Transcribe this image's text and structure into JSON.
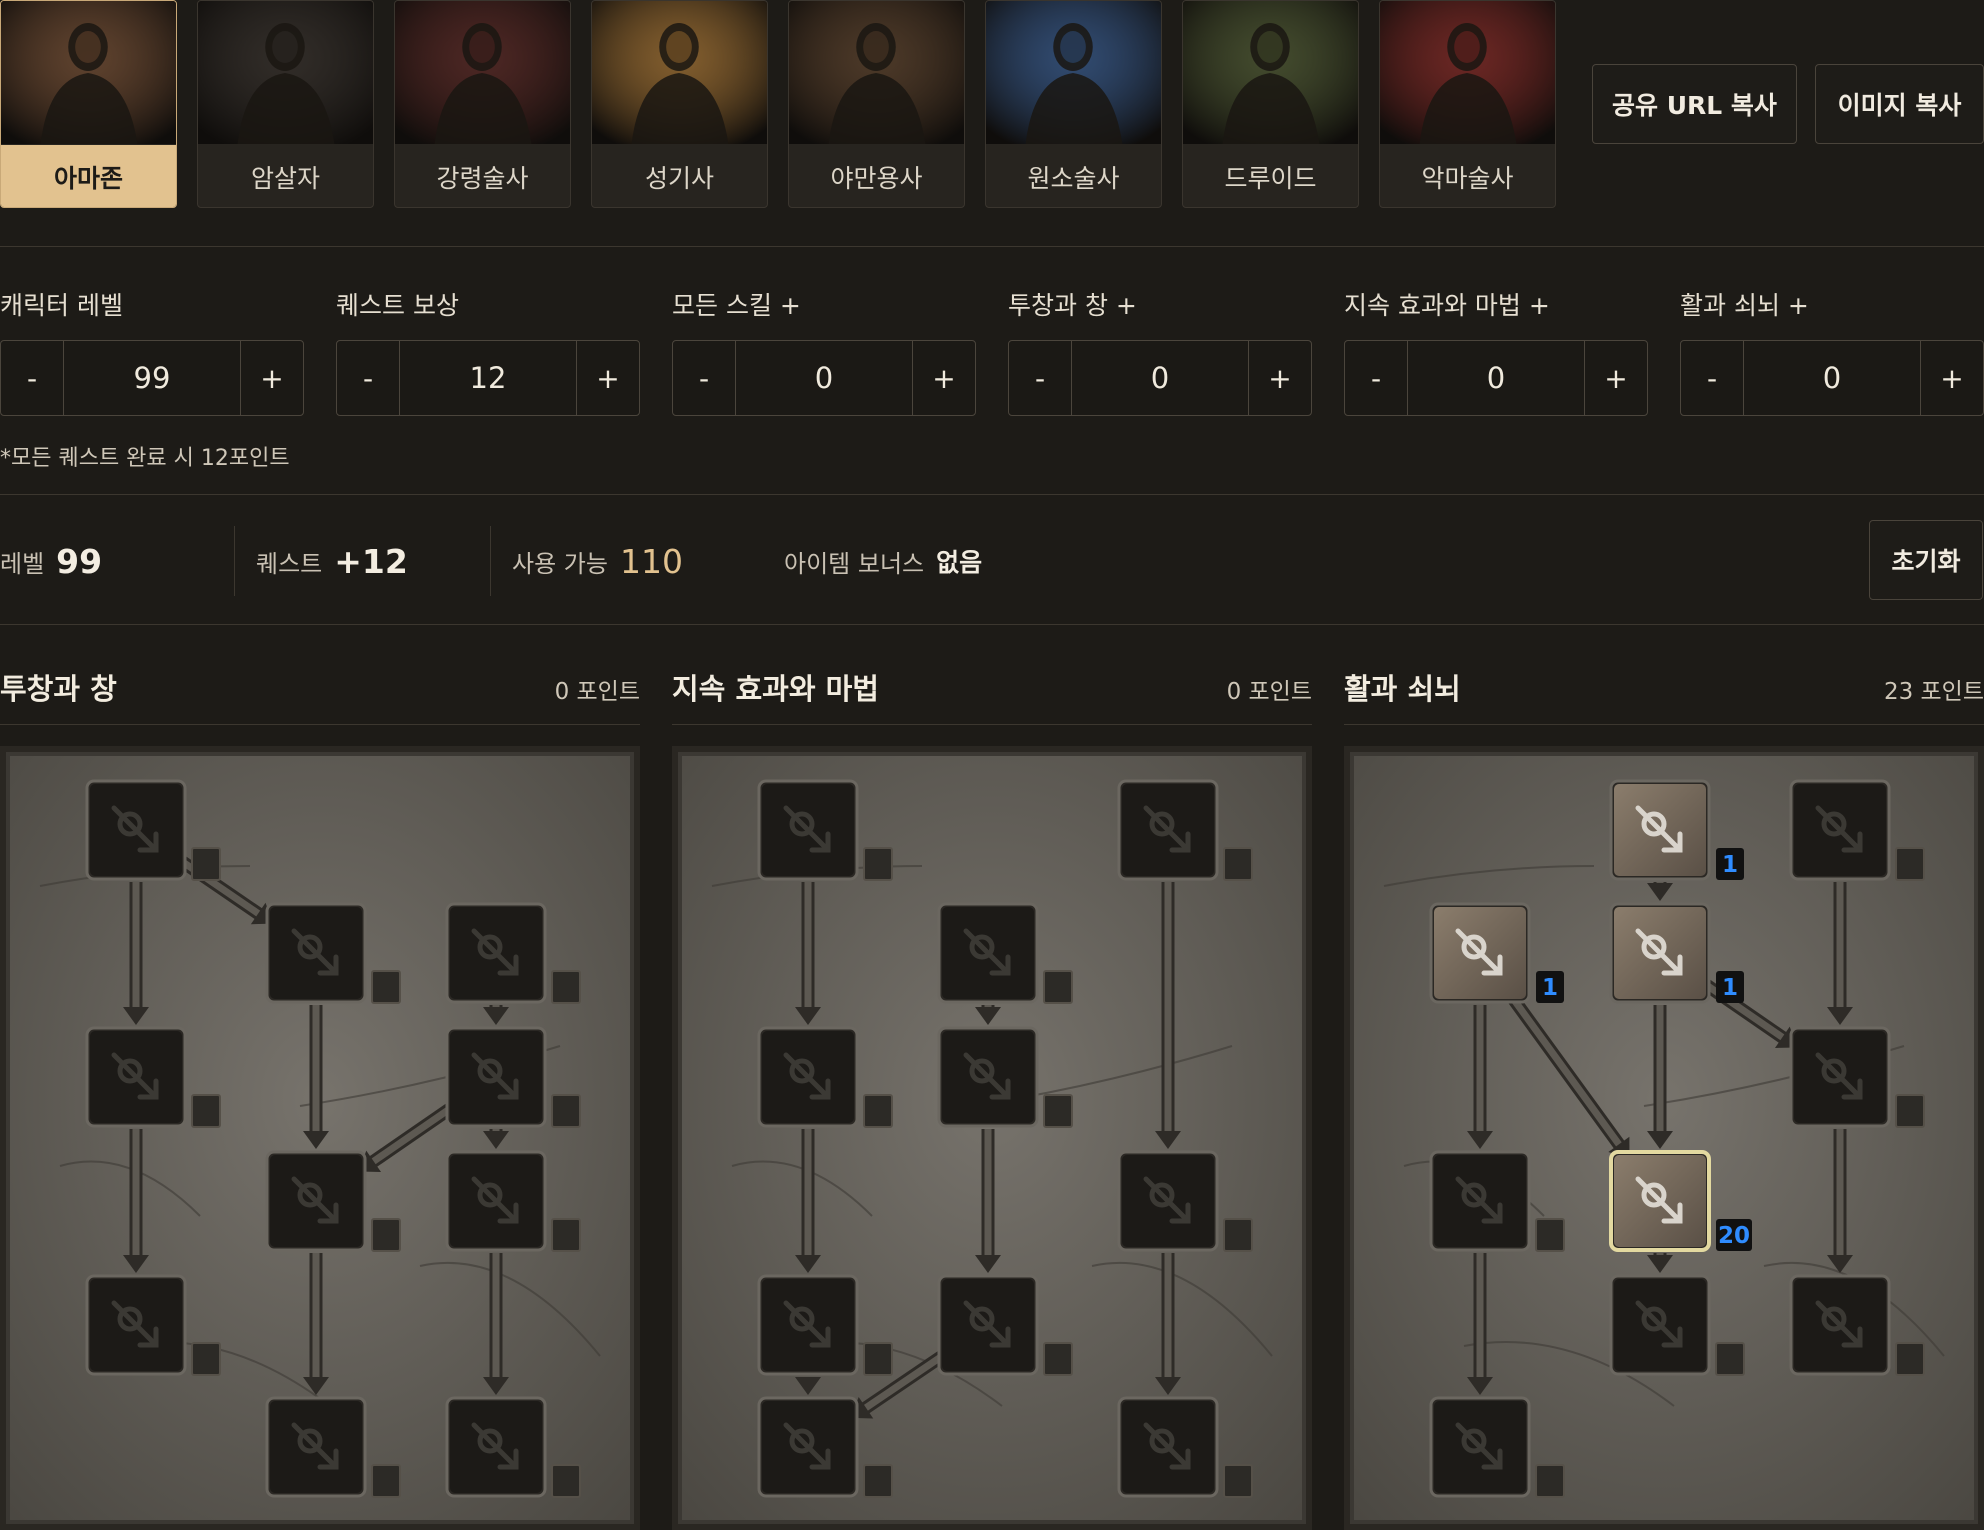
{
  "classes": [
    {
      "name": "아마존",
      "active": true,
      "accent": "#8a5a3a"
    },
    {
      "name": "암살자",
      "active": false,
      "accent": "#3a3430"
    },
    {
      "name": "강령술사",
      "active": false,
      "accent": "#6a2a28"
    },
    {
      "name": "성기사",
      "active": false,
      "accent": "#c88a3a"
    },
    {
      "name": "야만용사",
      "active": false,
      "accent": "#6a4a30"
    },
    {
      "name": "원소술사",
      "active": false,
      "accent": "#3a6ab0"
    },
    {
      "name": "드루이드",
      "active": false,
      "accent": "#5a6a3a"
    },
    {
      "name": "악마술사",
      "active": false,
      "accent": "#a02a28"
    }
  ],
  "actions": {
    "share_url": "공유 URL 복사",
    "copy_image": "이미지 복사"
  },
  "stats": [
    {
      "label": "캐릭터 레벨",
      "value": "99",
      "minus": "-",
      "plus": "+"
    },
    {
      "label": "퀘스트 보상",
      "value": "12",
      "minus": "-",
      "plus": "+"
    },
    {
      "label": "모든 스킬 +",
      "value": "0",
      "minus": "-",
      "plus": "+"
    },
    {
      "label": "투창과 창 +",
      "value": "0",
      "minus": "-",
      "plus": "+"
    },
    {
      "label": "지속 효과와 마법 +",
      "value": "0",
      "minus": "-",
      "plus": "+"
    },
    {
      "label": "활과 쇠뇌 +",
      "value": "0",
      "minus": "-",
      "plus": "+"
    }
  ],
  "quest_note": "*모든 퀘스트 완료 시 12포인트",
  "summary": {
    "level_label": "레벨",
    "level_value": "99",
    "quest_label": "퀘스트",
    "quest_value": "+12",
    "available_label": "사용 가능",
    "available_value": "110",
    "bonus_label": "아이템 보너스",
    "bonus_value": "없음",
    "reset": "초기화"
  },
  "colors": {
    "accent_gold": "#e2c28f",
    "skill_points_blue": "#2f8cff",
    "selected_border": "#e3d9a0"
  },
  "trees": [
    {
      "title": "투창과 창",
      "points": "0 포인트",
      "skills": [
        {
          "icon": "triple-arrow-icon",
          "col": 0,
          "row": 0,
          "points": 0
        },
        {
          "icon": "lightning-bolt-icon",
          "col": 1,
          "row": 1,
          "points": 0
        },
        {
          "icon": "scatter-shot-icon",
          "col": 2,
          "row": 1,
          "points": 0
        },
        {
          "icon": "fend-icon",
          "col": 0,
          "row": 2,
          "points": 0
        },
        {
          "icon": "ball-lightning-icon",
          "col": 2,
          "row": 2,
          "points": 0
        },
        {
          "icon": "strike-icon",
          "col": 1,
          "row": 3,
          "points": 0
        },
        {
          "icon": "lightning-web-icon",
          "col": 2,
          "row": 3,
          "points": 0
        },
        {
          "icon": "star-burst-icon",
          "col": 0,
          "row": 4,
          "points": 0
        },
        {
          "icon": "fury-icon",
          "col": 1,
          "row": 5,
          "points": 0
        },
        {
          "icon": "spiral-icon",
          "col": 2,
          "row": 5,
          "points": 0
        }
      ]
    },
    {
      "title": "지속 효과와 마법",
      "points": "0 포인트",
      "skills": [
        {
          "icon": "eye-icon",
          "col": 0,
          "row": 0,
          "points": 0
        },
        {
          "icon": "heart-dagger-icon",
          "col": 2,
          "row": 0,
          "points": 0
        },
        {
          "icon": "twin-figures-icon",
          "col": 1,
          "row": 1,
          "points": 0
        },
        {
          "icon": "swirl-icon",
          "col": 0,
          "row": 2,
          "points": 0
        },
        {
          "icon": "dodge-icon",
          "col": 1,
          "row": 2,
          "points": 0
        },
        {
          "icon": "cloak-icon",
          "col": 2,
          "row": 3,
          "points": 0
        },
        {
          "icon": "pair-icon",
          "col": 0,
          "row": 4,
          "points": 0
        },
        {
          "icon": "valkyrie-icon",
          "col": 1,
          "row": 4,
          "points": 0
        },
        {
          "icon": "helm-icon",
          "col": 0,
          "row": 5,
          "points": 0
        },
        {
          "icon": "shade-icon",
          "col": 2,
          "row": 5,
          "points": 0
        }
      ]
    },
    {
      "title": "활과 쇠뇌",
      "points": "23 포인트",
      "skills": [
        {
          "icon": "target-arrow-icon",
          "col": 1,
          "row": 0,
          "points": 1
        },
        {
          "icon": "fire-arrow-icon",
          "col": 2,
          "row": 0,
          "points": 0
        },
        {
          "icon": "cold-arrow-icon",
          "col": 0,
          "row": 1,
          "points": 1
        },
        {
          "icon": "multiple-shot-icon",
          "col": 1,
          "row": 1,
          "points": 1
        },
        {
          "icon": "explosive-icon",
          "col": 2,
          "row": 2,
          "points": 0
        },
        {
          "icon": "snowflake-icon",
          "col": 0,
          "row": 3,
          "points": 0
        },
        {
          "icon": "guided-arrow-icon",
          "col": 1,
          "row": 3,
          "points": 20,
          "selected": true
        },
        {
          "icon": "strafe-icon",
          "col": 1,
          "row": 4,
          "points": 0
        },
        {
          "icon": "immolation-icon",
          "col": 2,
          "row": 4,
          "points": 0
        },
        {
          "icon": "freezing-icon",
          "col": 0,
          "row": 5,
          "points": 0
        }
      ]
    }
  ]
}
